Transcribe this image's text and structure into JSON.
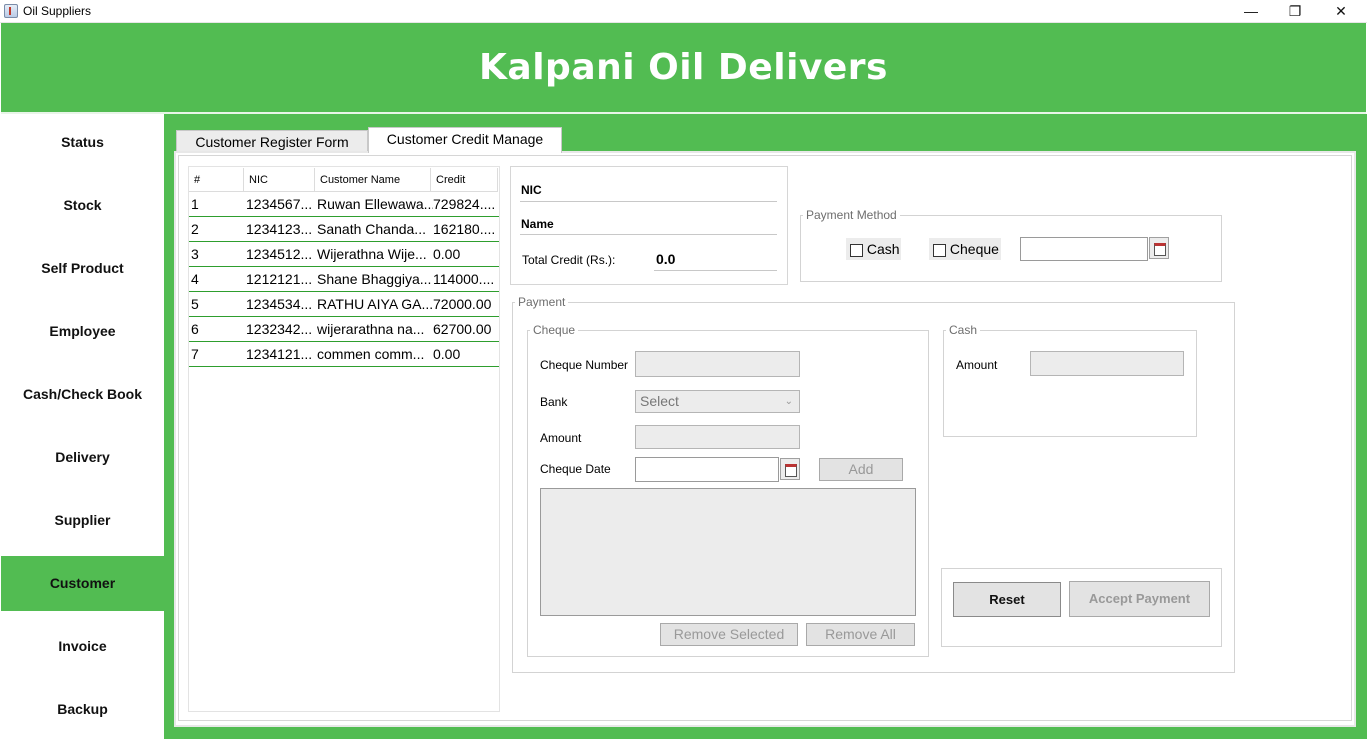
{
  "window": {
    "title": "Oil Suppliers",
    "minimize": "—",
    "maximize": "❐",
    "close": "✕"
  },
  "header": {
    "title": "Kalpani Oil Delivers"
  },
  "sidebar": {
    "items": [
      {
        "label": "Status"
      },
      {
        "label": "Stock"
      },
      {
        "label": "Self Product"
      },
      {
        "label": "Employee"
      },
      {
        "label": "Cash/Check Book"
      },
      {
        "label": "Delivery"
      },
      {
        "label": "Supplier"
      },
      {
        "label": "Customer",
        "active": true
      },
      {
        "label": "Invoice"
      },
      {
        "label": "Backup"
      }
    ]
  },
  "tabs": [
    {
      "label": "Customer Register Form"
    },
    {
      "label": "Customer Credit Manage",
      "selected": true
    }
  ],
  "table": {
    "headers": [
      "#",
      "NIC",
      "Customer Name",
      "Credit"
    ],
    "rows": [
      [
        "1",
        "1234567...",
        "Ruwan Ellewawa...",
        "729824...."
      ],
      [
        "2",
        "1234123...",
        "Sanath Chanda...",
        "162180...."
      ],
      [
        "3",
        "1234512...",
        "Wijerathna Wije...",
        "0.00"
      ],
      [
        "4",
        "1212121...",
        "Shane Bhaggiya...",
        "114000...."
      ],
      [
        "5",
        "1234534...",
        "RATHU AIYA GA...",
        "72000.00"
      ],
      [
        "6",
        "1232342...",
        "wijerarathna na...",
        "62700.00"
      ],
      [
        "7",
        "1234121...",
        "commen comm...",
        "0.00"
      ]
    ]
  },
  "info": {
    "nic_label": "NIC",
    "name_label": "Name",
    "total_credit_label": "Total Credit (Rs.):",
    "total_credit_value": "0.0"
  },
  "payment_method": {
    "legend": "Payment Method",
    "cash_label": "Cash",
    "cheque_label": "Cheque",
    "date_value": ""
  },
  "payment": {
    "legend": "Payment",
    "cheque": {
      "legend": "Cheque",
      "number_label": "Cheque Number",
      "bank_label": "Bank",
      "bank_selected": "Select",
      "amount_label": "Amount",
      "date_label": "Cheque Date",
      "add_label": "Add",
      "remove_selected_label": "Remove Selected",
      "remove_all_label": "Remove All"
    },
    "cash": {
      "legend": "Cash",
      "amount_label": "Amount"
    },
    "reset_label": "Reset",
    "accept_label": "Accept Payment"
  }
}
